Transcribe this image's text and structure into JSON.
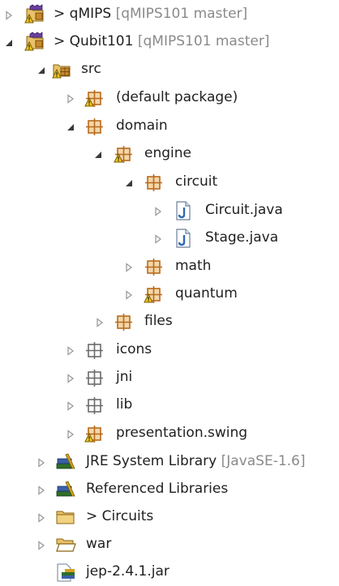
{
  "tree": {
    "items": [
      {
        "name": "project-qmips",
        "icon": "git-project-icon",
        "state": "collapsed",
        "prefix": "> ",
        "label": "qMIPS",
        "decoration": " [qMIPS101 master]",
        "depth": 0
      },
      {
        "name": "project-qubit101",
        "icon": "git-project-icon",
        "state": "expanded",
        "prefix": "> ",
        "label": "Qubit101",
        "decoration": " [qMIPS101 master]",
        "depth": 0
      },
      {
        "name": "folder-src",
        "icon": "source-folder-icon",
        "state": "expanded",
        "prefix": "",
        "label": "src",
        "decoration": "",
        "depth": 1
      },
      {
        "name": "package-default",
        "icon": "package-warning-icon",
        "state": "collapsed",
        "prefix": "",
        "label": "(default package)",
        "decoration": "",
        "depth": 2
      },
      {
        "name": "package-domain",
        "icon": "package-icon",
        "state": "expanded",
        "prefix": "",
        "label": "domain",
        "decoration": "",
        "depth": 2
      },
      {
        "name": "package-engine",
        "icon": "package-warning-icon",
        "state": "expanded",
        "prefix": "",
        "label": "engine",
        "decoration": "",
        "depth": 3
      },
      {
        "name": "package-circuit",
        "icon": "package-icon",
        "state": "expanded",
        "prefix": "",
        "label": "circuit",
        "decoration": "",
        "depth": 4
      },
      {
        "name": "file-circuit-java",
        "icon": "java-file-icon",
        "state": "collapsed",
        "prefix": "",
        "label": "Circuit.java",
        "decoration": "",
        "depth": 5
      },
      {
        "name": "file-stage-java",
        "icon": "java-file-icon",
        "state": "collapsed",
        "prefix": "",
        "label": "Stage.java",
        "decoration": "",
        "depth": 5
      },
      {
        "name": "package-math",
        "icon": "package-icon",
        "state": "collapsed",
        "prefix": "",
        "label": "math",
        "decoration": "",
        "depth": 4
      },
      {
        "name": "package-quantum",
        "icon": "package-warning-icon",
        "state": "collapsed",
        "prefix": "",
        "label": "quantum",
        "decoration": "",
        "depth": 4
      },
      {
        "name": "package-files",
        "icon": "package-icon",
        "state": "collapsed",
        "prefix": "",
        "label": "files",
        "decoration": "",
        "depth": 3
      },
      {
        "name": "package-icons",
        "icon": "empty-package-icon",
        "state": "collapsed",
        "prefix": "",
        "label": "icons",
        "decoration": "",
        "depth": 2
      },
      {
        "name": "package-jni",
        "icon": "empty-package-icon",
        "state": "collapsed",
        "prefix": "",
        "label": "jni",
        "decoration": "",
        "depth": 2
      },
      {
        "name": "package-lib",
        "icon": "empty-package-icon",
        "state": "collapsed",
        "prefix": "",
        "label": "lib",
        "decoration": "",
        "depth": 2
      },
      {
        "name": "package-presentation-swing",
        "icon": "package-warning-icon",
        "state": "collapsed",
        "prefix": "",
        "label": "presentation.swing",
        "decoration": "",
        "depth": 2
      },
      {
        "name": "library-jre-system",
        "icon": "library-icon",
        "state": "collapsed",
        "prefix": "",
        "label": "JRE System Library",
        "decoration": " [JavaSE-1.6]",
        "depth": 1
      },
      {
        "name": "library-referenced",
        "icon": "library-icon",
        "state": "collapsed",
        "prefix": "",
        "label": "Referenced Libraries",
        "decoration": "",
        "depth": 1
      },
      {
        "name": "folder-circuits",
        "icon": "folder-icon",
        "state": "collapsed",
        "prefix": "> ",
        "label": "Circuits",
        "decoration": "",
        "depth": 1
      },
      {
        "name": "folder-war",
        "icon": "folder-open-icon",
        "state": "collapsed",
        "prefix": "",
        "label": "war",
        "decoration": "",
        "depth": 1
      },
      {
        "name": "file-jep-jar",
        "icon": "jar-file-icon",
        "state": "none",
        "prefix": "",
        "label": "jep-2.4.1.jar",
        "decoration": "",
        "depth": 1
      }
    ]
  },
  "colors": {
    "text": "#1f1f1f",
    "decoration": "#8a8a8a",
    "twisty_collapsed": "#9a9a9a",
    "twisty_expanded": "#3a3a3a",
    "package_brown": "#b86a1c",
    "warning_yellow": "#f2c81d",
    "java_blue": "#2f67b8"
  }
}
